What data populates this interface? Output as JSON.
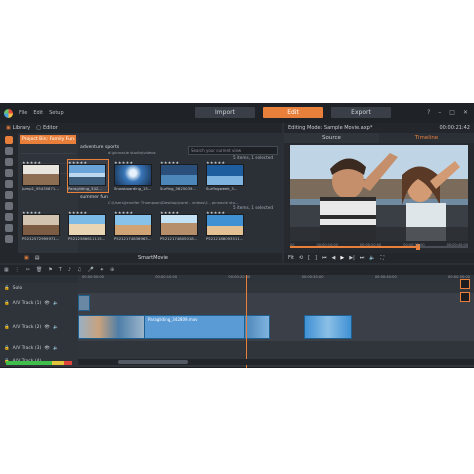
{
  "menu": {
    "items": [
      "File",
      "Edit",
      "Setup"
    ]
  },
  "nav": {
    "import": "Import",
    "edit": "Edit",
    "export": "Export"
  },
  "library": {
    "library_tab": "Library",
    "editor_tab": "Editor",
    "project_title": "Project Bin: Family Fun...",
    "group1": {
      "name": "adventure sports",
      "path": "d:\\pinnacle studio\\videos",
      "count": "5 items, 1 selected"
    },
    "group2": {
      "name": "summer fun",
      "path": "C:\\Users\\Jennifer Thompson\\Desktop\\corel - videos\\1 - pinnacle stu...",
      "count": "5 items, 1 selected"
    },
    "search_placeholder": "Search your current view",
    "row1": [
      "Jump1_95435871...",
      "Paragliding_342...",
      "Snowboarding_15...",
      "Surfing_5625039...",
      "Surfingweek_5..."
    ],
    "row2": [
      "P5212572995971...",
      "P5212586611115...",
      "P5212174836963...",
      "P5212174805018...",
      "P5212188093511..."
    ],
    "smartmovie": "SmartMovie"
  },
  "editor": {
    "title": "Editing Mode: Sample Movie.axp*",
    "timecode": "00:00:21:42",
    "source_tab": "Source",
    "timeline_tab": "Timeline",
    "ticks": [
      "00",
      "00:00:10:00",
      "00:00:20:00",
      "00:00:30:00",
      "00:00:40:00"
    ],
    "fit": "Fit"
  },
  "timeline": {
    "tracks": [
      {
        "name": "Solo"
      },
      {
        "name": "A/V Track (1)"
      },
      {
        "name": "A/V Track (2)"
      },
      {
        "name": "A/V Track (3)"
      },
      {
        "name": "A/V Track (4)"
      }
    ],
    "clip_label": "Paragliding_342809.mov",
    "ruler": [
      "00:00:00:00",
      "00:00:10:00",
      "00:00:20:00",
      "00:00:30:00",
      "00:00:40:00",
      "00:00:50:00"
    ]
  },
  "colors": {
    "accent": "#e8803c",
    "panel": "#2b2f36"
  }
}
